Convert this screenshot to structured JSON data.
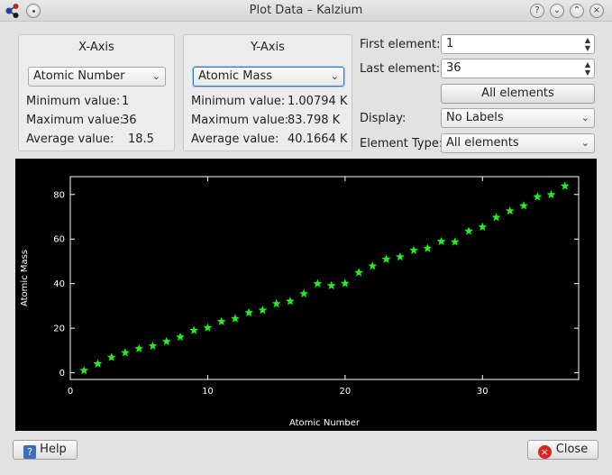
{
  "window": {
    "title": "Plot Data – Kalzium"
  },
  "titlebar": {
    "help_symbol": "?",
    "shade_symbol": "⌄",
    "maximize_symbol": "⌃",
    "close_symbol": "×"
  },
  "x_axis": {
    "title": "X-Axis",
    "selected": "Atomic Number",
    "stats": [
      {
        "label": "Minimum value:",
        "value": "1"
      },
      {
        "label": "Maximum value:",
        "value": "36"
      },
      {
        "label": "Average value:",
        "value": "18.5"
      }
    ]
  },
  "y_axis": {
    "title": "Y-Axis",
    "selected": "Atomic Mass",
    "stats": [
      {
        "label": "Minimum value:",
        "value": "1.00794 K"
      },
      {
        "label": "Maximum value:",
        "value": "83.798 K"
      },
      {
        "label": "Average value:",
        "value": "40.1664 K"
      }
    ]
  },
  "form": {
    "first_element_label": "First element:",
    "first_element_value": "1",
    "last_element_label": "Last element:",
    "last_element_value": "36",
    "all_elements_button": "All elements",
    "display_label": "Display:",
    "display_value": "No Labels",
    "element_type_label": "Element Type:",
    "element_type_value": "All elements"
  },
  "buttons": {
    "help": "Help",
    "close": "Close"
  },
  "colors": {
    "marker": "#22ee22",
    "plot_bg": "#000000",
    "axis": "#ffffff"
  },
  "chart_data": {
    "type": "scatter",
    "xlabel": "Atomic Number",
    "ylabel": "Atomic Mass",
    "xlim": [
      0,
      37
    ],
    "ylim": [
      -3,
      88
    ],
    "x_ticks": [
      0,
      10,
      20,
      30
    ],
    "y_ticks": [
      0,
      20,
      40,
      60,
      80
    ],
    "grid": false,
    "marker": "star",
    "points": [
      [
        1,
        1.008
      ],
      [
        2,
        4.003
      ],
      [
        3,
        6.94
      ],
      [
        4,
        9.012
      ],
      [
        5,
        10.81
      ],
      [
        6,
        12.011
      ],
      [
        7,
        14.007
      ],
      [
        8,
        15.999
      ],
      [
        9,
        18.998
      ],
      [
        10,
        20.18
      ],
      [
        11,
        22.99
      ],
      [
        12,
        24.305
      ],
      [
        13,
        26.982
      ],
      [
        14,
        28.085
      ],
      [
        15,
        30.974
      ],
      [
        16,
        32.06
      ],
      [
        17,
        35.45
      ],
      [
        18,
        39.948
      ],
      [
        19,
        39.098
      ],
      [
        20,
        40.078
      ],
      [
        21,
        44.956
      ],
      [
        22,
        47.867
      ],
      [
        23,
        50.942
      ],
      [
        24,
        51.996
      ],
      [
        25,
        54.938
      ],
      [
        26,
        55.845
      ],
      [
        27,
        58.933
      ],
      [
        28,
        58.693
      ],
      [
        29,
        63.546
      ],
      [
        30,
        65.38
      ],
      [
        31,
        69.723
      ],
      [
        32,
        72.63
      ],
      [
        33,
        74.922
      ],
      [
        34,
        78.971
      ],
      [
        35,
        79.904
      ],
      [
        36,
        83.798
      ]
    ]
  }
}
